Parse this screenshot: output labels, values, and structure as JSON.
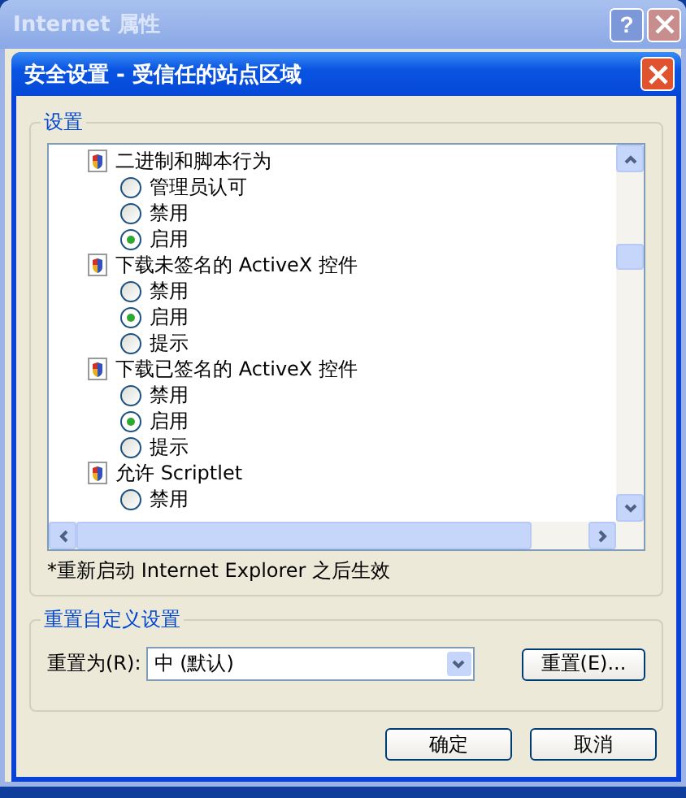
{
  "background_window": {
    "title": "Internet 属性",
    "help_button": "?"
  },
  "dialog": {
    "title": "安全设置 - 受信任的站点区域",
    "settings_group": {
      "label": "设置",
      "tree": [
        {
          "label": "二进制和脚本行为",
          "children": [
            {
              "label": "管理员认可",
              "selected": false
            },
            {
              "label": "禁用",
              "selected": false
            },
            {
              "label": "启用",
              "selected": true
            }
          ]
        },
        {
          "label": "下载未签名的 ActiveX 控件",
          "children": [
            {
              "label": "禁用",
              "selected": false
            },
            {
              "label": "启用",
              "selected": true
            },
            {
              "label": "提示",
              "selected": false
            }
          ]
        },
        {
          "label": "下载已签名的 ActiveX 控件",
          "children": [
            {
              "label": "禁用",
              "selected": false
            },
            {
              "label": "启用",
              "selected": true
            },
            {
              "label": "提示",
              "selected": false
            }
          ]
        },
        {
          "label": "允许 Scriptlet",
          "children": [
            {
              "label": "禁用",
              "selected": false
            }
          ]
        }
      ],
      "note": "*重新启动 Internet Explorer 之后生效"
    },
    "reset_group": {
      "label": "重置自定义设置",
      "reset_to_label": "重置为(R):",
      "dropdown_value": "中 (默认)",
      "reset_button": "重置(E)..."
    },
    "buttons": [
      "确定",
      "取消"
    ]
  }
}
